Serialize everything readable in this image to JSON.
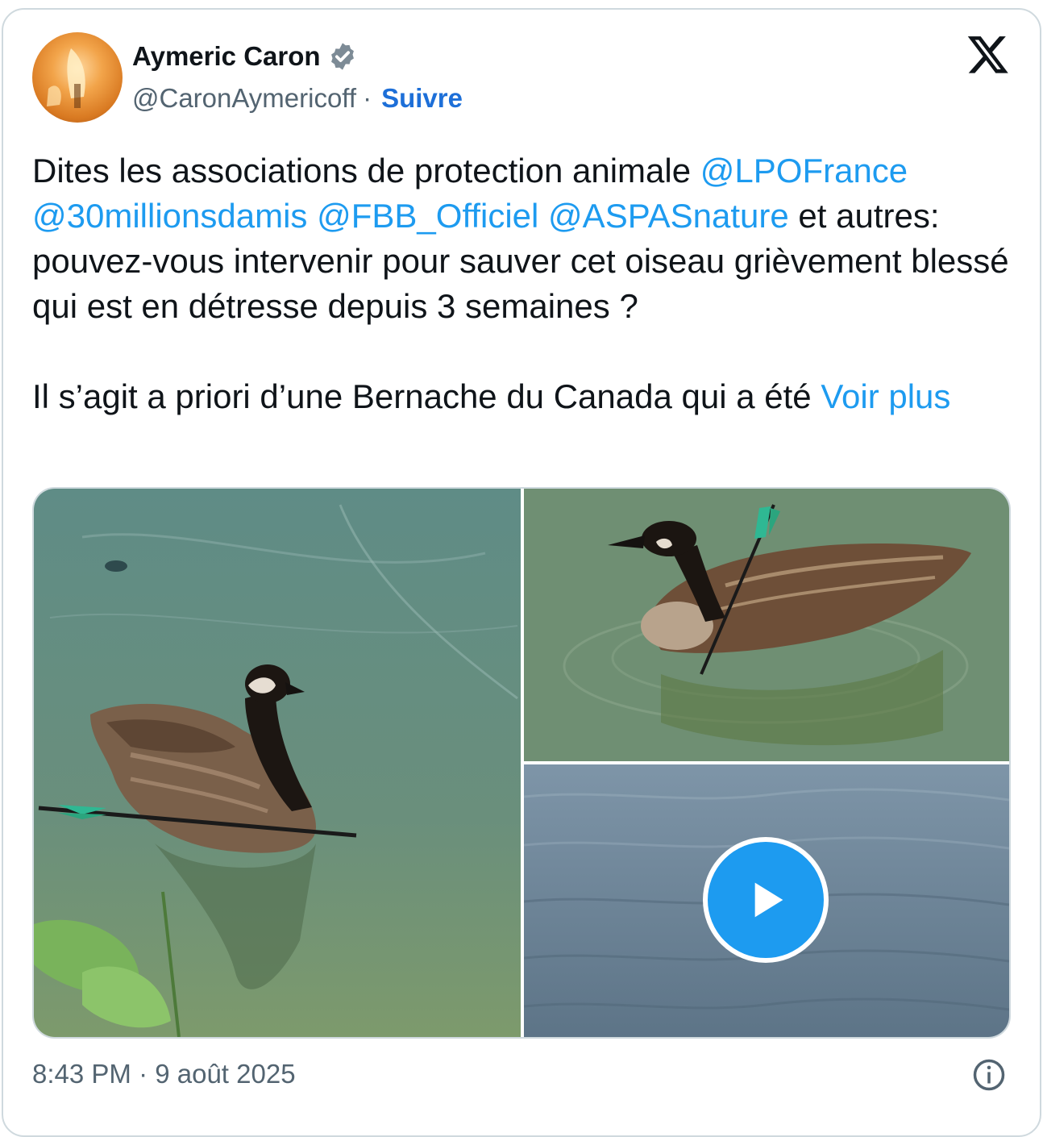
{
  "tweet": {
    "author_name": "Aymeric Caron",
    "handle": "@CaronAymericoff",
    "separator": "·",
    "follow_label": "Suivre",
    "text_part1": "Dites les associations de protection animale ",
    "mentions": [
      "@LPOFrance",
      "@30millionsdamis",
      "@FBB_Officiel",
      "@ASPASnature"
    ],
    "text_part2": " et autres: pouvez-vous intervenir pour sauver cet oiseau grièvement blessé qui est en détresse depuis 3 semaines ?",
    "text_part3": "Il s’agit a priori d’une Bernache du Canada qui a été ",
    "more_label": "Voir plus",
    "timestamp": "8:43 PM · 9 août 2025"
  },
  "icons": {
    "verified": "verified-badge-icon",
    "logo": "x-logo-icon",
    "play": "play-icon",
    "info": "info-icon"
  },
  "colors": {
    "link": "#1d9bf0",
    "follow": "#1d6fd8",
    "secondary_text": "#536471",
    "border": "#cfd9de"
  }
}
